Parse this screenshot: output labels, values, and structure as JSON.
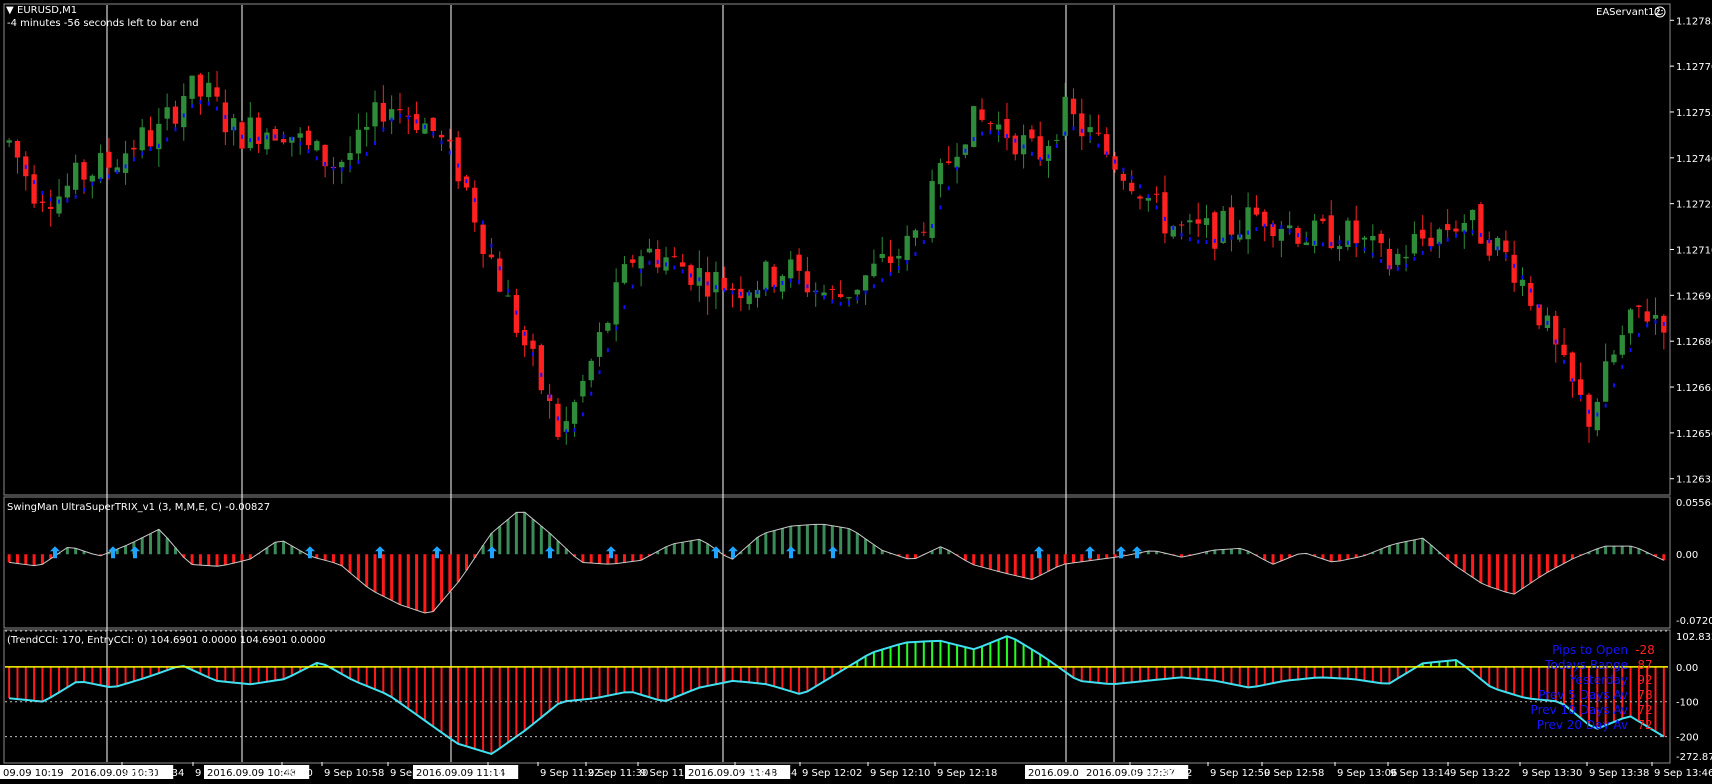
{
  "window": {
    "symbol_title": "EURUSD,M1",
    "bar_timer": "-4 minutes -56 seconds left to bar end",
    "ea_label": "EAServant12",
    "ea_icon": "smiley-face-icon"
  },
  "colors": {
    "background": "#000000",
    "bull": "#2e8b3a",
    "bear": "#ff2020",
    "ma": "#1010ff",
    "trix_up": "#3c8c5a",
    "trix_down": "#ff1a1a",
    "arrow": "#1ea5ff",
    "cci_line": "#40e0f0",
    "cci_up": "#20ff20",
    "cci_down": "#ff1a1a",
    "zero_line": "#ffff00",
    "vline": "#ffffff"
  },
  "panels": {
    "trix": {
      "label": "SwingMan UltraSuperTRIX_v1 (3, M,M,E, C) -0.00827",
      "scale": [
        "0.05568",
        "0.00",
        "-0.07202"
      ]
    },
    "cci": {
      "label": "(TrendCCI: 170, EntryCCI: 0)  104.6901  0.0000  104.6901  0.0000",
      "scale": [
        "102.8328",
        "0.00",
        "-100",
        "-200",
        "-272.8768"
      ]
    }
  },
  "stats": [
    {
      "label": "Pips to Open",
      "value": "-28"
    },
    {
      "label": "Todays Range",
      "value": "87"
    },
    {
      "label": "Yesterday",
      "value": "92"
    },
    {
      "label": "Prev 5 Days Av",
      "value": "78"
    },
    {
      "label": "Prev 10 Days Av",
      "value": "72"
    },
    {
      "label": "Prev 20 Day Av",
      "value": "72"
    }
  ],
  "time_axis": [
    {
      "label": "09.09 10:19",
      "boxed": true
    },
    {
      "label": "2016.09.09 10:31",
      "boxed": true
    },
    {
      "label": "9 Sep 10:34",
      "boxed": false
    },
    {
      "label": "9",
      "boxed": false
    },
    {
      "label": "2016.09.09 10:48",
      "boxed": true
    },
    {
      "label": "10:50",
      "boxed": false
    },
    {
      "label": "9 Sep 10:58",
      "boxed": false
    },
    {
      "label": "9 Sep",
      "boxed": false
    },
    {
      "label": "2016.09.09 11:14",
      "boxed": true
    },
    {
      "label": "14",
      "boxed": false
    },
    {
      "label": "9 Sep 11:22",
      "boxed": false
    },
    {
      "label": "9 Sep 11:30",
      "boxed": false
    },
    {
      "label": "9 Sep 11:",
      "boxed": false
    },
    {
      "label": "2016.09.09 11:48",
      "boxed": true
    },
    {
      "label": "9 Sep 11:54",
      "boxed": false
    },
    {
      "label": "9 Sep 12:02",
      "boxed": false
    },
    {
      "label": "9 Sep 12:10",
      "boxed": false
    },
    {
      "label": "9 Sep 12:18",
      "boxed": false
    },
    {
      "label": "2016.09.0",
      "boxed": true
    },
    {
      "label": "2016.09.09 12:37",
      "boxed": true
    },
    {
      "label": "9 Sep 12:42",
      "boxed": false
    },
    {
      "label": "9 Sep 12:50",
      "boxed": false
    },
    {
      "label": "9 Sep 12:58",
      "boxed": false
    },
    {
      "label": "9 Sep 13:06",
      "boxed": false
    },
    {
      "label": "9 Sep 13:14",
      "boxed": false
    },
    {
      "label": "9 Sep 13:22",
      "boxed": false
    },
    {
      "label": "9 Sep 13:30",
      "boxed": false
    },
    {
      "label": "9 Sep 13:38",
      "boxed": false
    },
    {
      "label": "9 Sep 13:46",
      "boxed": false
    }
  ],
  "chart_data": {
    "type": "candlestick",
    "symbol": "EURUSD",
    "timeframe": "M1",
    "ylim": [
      1.1263,
      1.1279
    ],
    "y_ticks": [
      "1.12785",
      "1.12770",
      "1.12755",
      "1.12740",
      "1.12725",
      "1.12710",
      "1.12695",
      "1.12680",
      "1.12665",
      "1.12650",
      "1.12635"
    ],
    "vertical_markers": [
      "2016.09.09 10:31",
      "2016.09.09 10:48",
      "2016.09.09 11:14",
      "2016.09.09 11:48",
      "2016.09.09 12:3x",
      "2016.09.09 12:37"
    ],
    "price_path": [
      [
        0,
        1.12745
      ],
      [
        10,
        1.1273
      ],
      [
        20,
        1.12728
      ],
      [
        30,
        1.12735
      ],
      [
        40,
        1.12738
      ],
      [
        50,
        1.12745
      ],
      [
        60,
        1.12748
      ],
      [
        70,
        1.12762
      ],
      [
        80,
        1.1276
      ],
      [
        90,
        1.12748
      ],
      [
        100,
        1.1275
      ],
      [
        110,
        1.1275
      ],
      [
        120,
        1.12742
      ],
      [
        130,
        1.12738
      ],
      [
        140,
        1.12744
      ],
      [
        150,
        1.12758
      ],
      [
        160,
        1.12755
      ],
      [
        170,
        1.12748
      ],
      [
        180,
        1.12735
      ],
      [
        190,
        1.12712
      ],
      [
        200,
        1.1269
      ],
      [
        210,
        1.1267
      ],
      [
        220,
        1.12648
      ],
      [
        230,
        1.12668
      ],
      [
        240,
        1.1269
      ],
      [
        250,
        1.1271
      ],
      [
        260,
        1.12708
      ],
      [
        270,
        1.12704
      ],
      [
        280,
        1.127
      ],
      [
        290,
        1.12698
      ],
      [
        300,
        1.127
      ],
      [
        310,
        1.12704
      ],
      [
        320,
        1.12698
      ],
      [
        330,
        1.12694
      ],
      [
        340,
        1.127
      ],
      [
        350,
        1.12706
      ],
      [
        360,
        1.12712
      ],
      [
        370,
        1.1273
      ],
      [
        380,
        1.1275
      ],
      [
        390,
        1.12752
      ],
      [
        400,
        1.12748
      ],
      [
        410,
        1.1274
      ],
      [
        420,
        1.12755
      ],
      [
        430,
        1.12748
      ],
      [
        440,
        1.1274
      ],
      [
        450,
        1.12732
      ],
      [
        460,
        1.1272
      ],
      [
        470,
        1.12715
      ],
      [
        480,
        1.12716
      ],
      [
        490,
        1.12718
      ],
      [
        500,
        1.12722
      ],
      [
        510,
        1.12718
      ],
      [
        520,
        1.12714
      ],
      [
        530,
        1.12716
      ],
      [
        540,
        1.12712
      ],
      [
        550,
        1.12705
      ],
      [
        560,
        1.12712
      ],
      [
        570,
        1.12716
      ],
      [
        580,
        1.1272
      ],
      [
        590,
        1.12714
      ],
      [
        600,
        1.12705
      ],
      [
        610,
        1.1269
      ],
      [
        620,
        1.1267
      ],
      [
        630,
        1.12655
      ],
      [
        640,
        1.12675
      ],
      [
        650,
        1.1269
      ],
      [
        660,
        1.12688
      ]
    ],
    "trix": {
      "ylim": [
        -0.07202,
        0.05568
      ],
      "path": [
        [
          0,
          -0.008
        ],
        [
          10,
          -0.012
        ],
        [
          20,
          0.008
        ],
        [
          30,
          -0.002
        ],
        [
          40,
          0.01
        ],
        [
          50,
          0.025
        ],
        [
          60,
          -0.01
        ],
        [
          70,
          -0.012
        ],
        [
          80,
          -0.005
        ],
        [
          90,
          0.015
        ],
        [
          100,
          -0.002
        ],
        [
          110,
          -0.01
        ],
        [
          120,
          -0.035
        ],
        [
          130,
          -0.05
        ],
        [
          140,
          -0.06
        ],
        [
          150,
          -0.025
        ],
        [
          160,
          0.02
        ],
        [
          170,
          0.045
        ],
        [
          180,
          0.02
        ],
        [
          190,
          -0.008
        ],
        [
          200,
          -0.01
        ],
        [
          210,
          -0.006
        ],
        [
          220,
          0.01
        ],
        [
          230,
          0.015
        ],
        [
          240,
          -0.006
        ],
        [
          250,
          0.02
        ],
        [
          260,
          0.028
        ],
        [
          270,
          0.03
        ],
        [
          280,
          0.025
        ],
        [
          290,
          0.004
        ],
        [
          300,
          -0.006
        ],
        [
          310,
          0.008
        ],
        [
          320,
          -0.01
        ],
        [
          330,
          -0.018
        ],
        [
          340,
          -0.025
        ],
        [
          350,
          -0.01
        ],
        [
          360,
          -0.006
        ],
        [
          370,
          -0.002
        ],
        [
          380,
          0.004
        ],
        [
          390,
          -0.003
        ],
        [
          400,
          0.004
        ],
        [
          410,
          0.006
        ],
        [
          420,
          -0.01
        ],
        [
          430,
          0.002
        ],
        [
          440,
          -0.008
        ],
        [
          450,
          -0.002
        ],
        [
          460,
          0.01
        ],
        [
          470,
          0.016
        ],
        [
          480,
          -0.01
        ],
        [
          490,
          -0.03
        ],
        [
          500,
          -0.04
        ],
        [
          510,
          -0.02
        ],
        [
          520,
          -0.004
        ],
        [
          530,
          0.008
        ],
        [
          540,
          0.008
        ],
        [
          550,
          -0.006
        ]
      ],
      "arrows_at": [
        50,
        108,
        130,
        305,
        375,
        432,
        487,
        545,
        606,
        711,
        728,
        786,
        828,
        1034,
        1085,
        1116,
        1132
      ]
    },
    "cci": {
      "ylim": [
        -272.8768,
        102.8328
      ],
      "path": [
        [
          0,
          -90
        ],
        [
          10,
          -100
        ],
        [
          20,
          -40
        ],
        [
          30,
          -60
        ],
        [
          40,
          -30
        ],
        [
          50,
          5
        ],
        [
          60,
          -40
        ],
        [
          70,
          -50
        ],
        [
          80,
          -35
        ],
        [
          90,
          15
        ],
        [
          100,
          -40
        ],
        [
          110,
          -80
        ],
        [
          120,
          -150
        ],
        [
          130,
          -220
        ],
        [
          140,
          -250
        ],
        [
          150,
          -180
        ],
        [
          160,
          -100
        ],
        [
          170,
          -90
        ],
        [
          180,
          -70
        ],
        [
          190,
          -100
        ],
        [
          200,
          -60
        ],
        [
          210,
          -40
        ],
        [
          220,
          -50
        ],
        [
          230,
          -80
        ],
        [
          240,
          -20
        ],
        [
          250,
          40
        ],
        [
          260,
          70
        ],
        [
          270,
          75
        ],
        [
          280,
          50
        ],
        [
          290,
          90
        ],
        [
          300,
          30
        ],
        [
          310,
          -40
        ],
        [
          320,
          -50
        ],
        [
          330,
          -40
        ],
        [
          340,
          -30
        ],
        [
          350,
          -40
        ],
        [
          360,
          -60
        ],
        [
          370,
          -40
        ],
        [
          380,
          -30
        ],
        [
          390,
          -35
        ],
        [
          400,
          -50
        ],
        [
          410,
          10
        ],
        [
          420,
          20
        ],
        [
          430,
          -60
        ],
        [
          440,
          -90
        ],
        [
          450,
          -100
        ],
        [
          460,
          -180
        ],
        [
          470,
          -140
        ],
        [
          480,
          -200
        ]
      ]
    }
  }
}
